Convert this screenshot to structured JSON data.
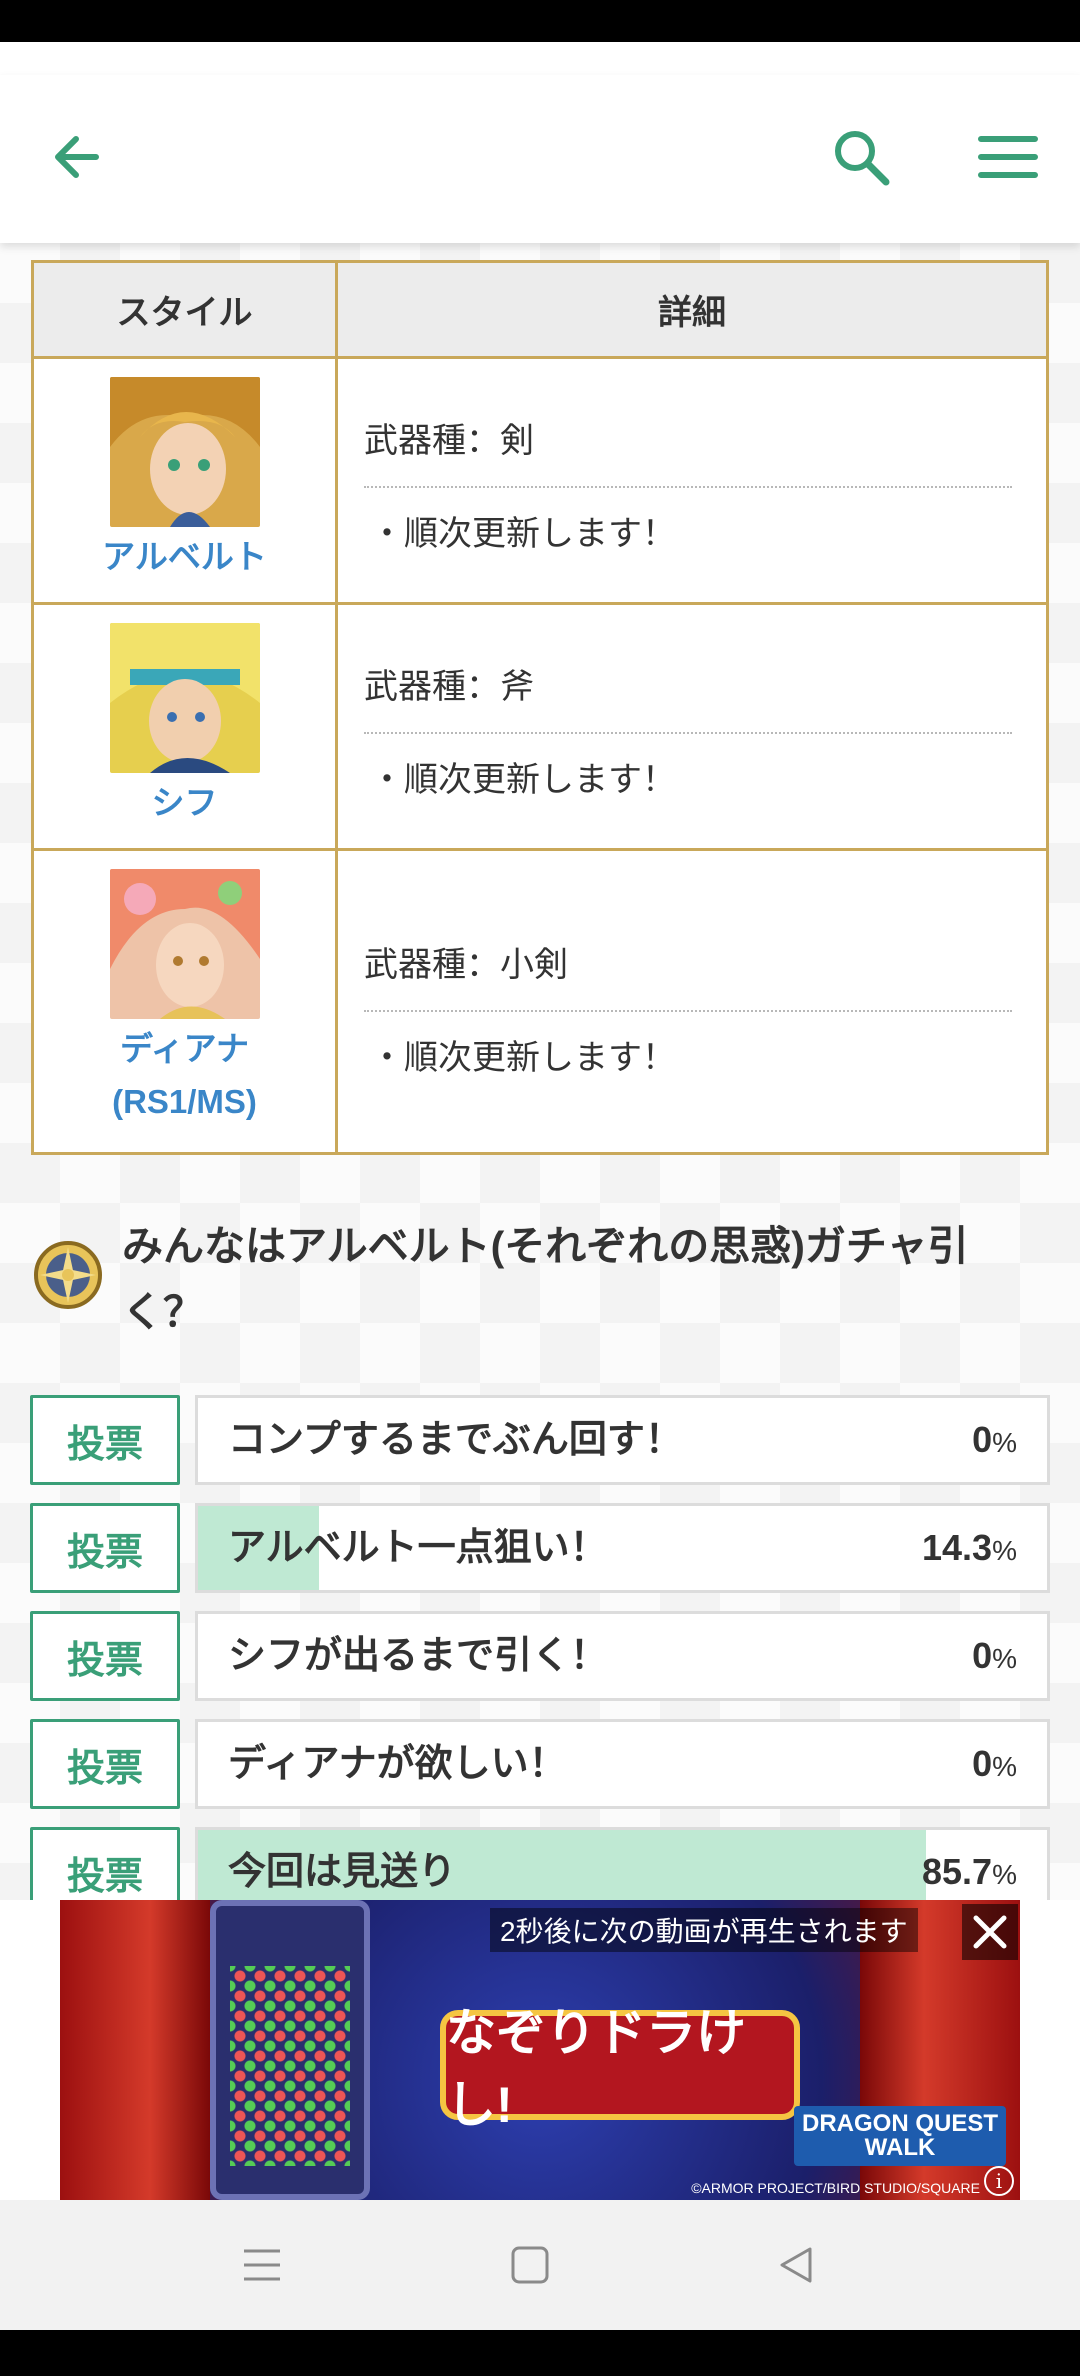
{
  "header": {
    "back_icon": "arrow-left-icon",
    "search_icon": "search-icon",
    "menu_icon": "hamburger-menu-icon",
    "accent_color": "#3a9f78"
  },
  "table": {
    "headers": {
      "style": "スタイル",
      "detail": "詳細"
    },
    "rows": [
      {
        "name": "アルベルト",
        "weapon": "武器種：剣",
        "note": "・順次更新します！"
      },
      {
        "name": "シフ",
        "weapon": "武器種：斧",
        "note": "・順次更新します！"
      },
      {
        "name": "ディアナ",
        "name2": "(RS1/MS)",
        "weapon": "武器種：小剣",
        "note": "・順次更新します！"
      }
    ]
  },
  "poll": {
    "title": "みんなはアルベルト(それぞれの思惑)ガチャ引く？",
    "vote_label": "投票",
    "options": [
      {
        "label": "コンプするまでぶん回す！",
        "pct": "0",
        "value": 0
      },
      {
        "label": "アルベルト一点狙い！",
        "pct": "14.3",
        "value": 14.3
      },
      {
        "label": "シフが出るまで引く！",
        "pct": "0",
        "value": 0
      },
      {
        "label": "ディアナが欲しい！",
        "pct": "0",
        "value": 0
      },
      {
        "label": "今回は見送り",
        "pct": "85.7",
        "value": 85.7
      }
    ],
    "pct_unit": "%"
  },
  "ad": {
    "notice": "2秒後に次の動画が再生されます",
    "logo_text": "なぞりドラけし!",
    "brand_line1": "DRAGON QUEST",
    "brand_line2": "WALK",
    "credit": "©ARMOR PROJECT/BIRD STUDIO/SQUARE",
    "info": "i"
  }
}
